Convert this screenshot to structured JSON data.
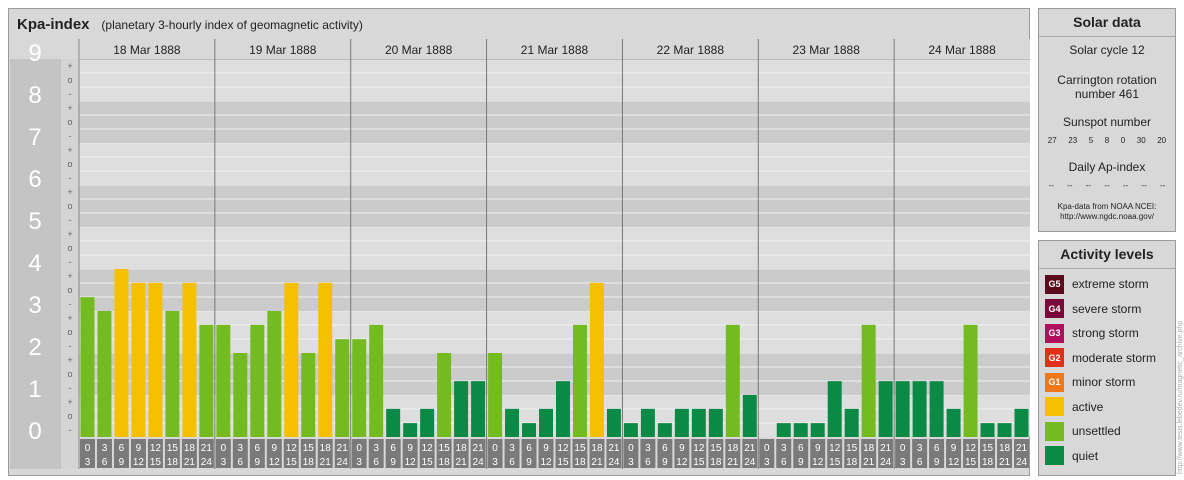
{
  "header": {
    "title": "Kpa-index",
    "subtitle": "(planetary 3-hourly index of geomagnetic activity)"
  },
  "chart_data": {
    "type": "bar",
    "title": "Kpa-index",
    "subtitle": "(planetary 3-hourly index of geomagnetic activity)",
    "ylim": [
      0,
      9
    ],
    "y_ticks": [
      "0",
      "1",
      "2",
      "3",
      "4",
      "5",
      "6",
      "7",
      "8",
      "9"
    ],
    "y_subticks": [
      "+",
      "o",
      "-"
    ],
    "days": [
      "18 Mar 1888",
      "19 Mar 1888",
      "20 Mar 1888",
      "21 Mar 1888",
      "22 Mar 1888",
      "23 Mar 1888",
      "24 Mar 1888"
    ],
    "interval_starts": [
      "0",
      "3",
      "6",
      "9",
      "12",
      "15",
      "18",
      "21"
    ],
    "interval_ends": [
      "3",
      "6",
      "9",
      "12",
      "15",
      "18",
      "21",
      "24"
    ],
    "values": [
      3.33,
      3.0,
      4.0,
      3.67,
      3.67,
      3.0,
      3.67,
      2.67,
      2.67,
      2.0,
      2.67,
      3.0,
      3.67,
      2.0,
      3.67,
      2.33,
      2.33,
      2.67,
      0.67,
      0.33,
      0.67,
      2.0,
      1.33,
      1.33,
      2.0,
      0.67,
      0.33,
      0.67,
      1.33,
      2.67,
      3.67,
      0.67,
      0.33,
      0.67,
      0.33,
      0.67,
      0.67,
      0.67,
      2.67,
      1.0,
      0.0,
      0.33,
      0.33,
      0.33,
      1.33,
      0.67,
      2.67,
      1.33,
      1.33,
      1.33,
      1.33,
      0.67,
      2.67,
      0.33,
      0.33,
      0.67
    ],
    "level_colors": {
      "quiet": "#0a8a45",
      "unsettled": "#74bb22",
      "active": "#f6c000"
    }
  },
  "solar": {
    "heading": "Solar data",
    "cycle": "Solar cycle 12",
    "carrington": "Carrington rotation number 461",
    "sunspot_label": "Sunspot number",
    "sunspots": [
      "27",
      "23",
      "5",
      "8",
      "0",
      "30",
      "20"
    ],
    "ap_label": "Daily Ap-index",
    "ap_values": [
      "--",
      "--",
      "--",
      "--",
      "--",
      "--",
      "--"
    ],
    "credit_line1": "Kpa-data from NOAA NCEI:",
    "credit_line2": "http://www.ngdc.noaa.gov/"
  },
  "activity": {
    "heading": "Activity levels",
    "levels": [
      {
        "badge": "G5",
        "label": "extreme storm",
        "color": "#5c0a1e"
      },
      {
        "badge": "G4",
        "label": "severe storm",
        "color": "#7a0a3a"
      },
      {
        "badge": "G3",
        "label": "strong storm",
        "color": "#b0105e"
      },
      {
        "badge": "G2",
        "label": "moderate storm",
        "color": "#e0301a"
      },
      {
        "badge": "G1",
        "label": "minor storm",
        "color": "#f07818"
      },
      {
        "badge": "",
        "label": "active",
        "color": "#f6c000"
      },
      {
        "badge": "",
        "label": "unsettled",
        "color": "#74bb22"
      },
      {
        "badge": "",
        "label": "quiet",
        "color": "#0a8a45"
      }
    ]
  },
  "credit": "http://www.tesis.lebedev.ru/magnetic_archive.php"
}
